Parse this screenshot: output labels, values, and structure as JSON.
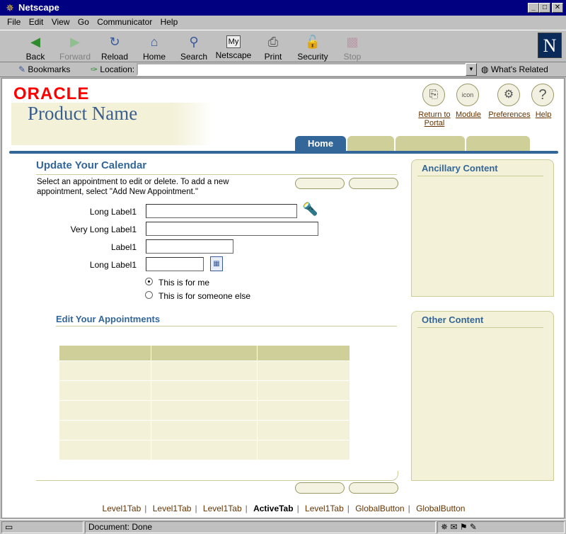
{
  "window": {
    "title": "Netscape"
  },
  "menu": [
    "File",
    "Edit",
    "View",
    "Go",
    "Communicator",
    "Help"
  ],
  "toolbar": [
    {
      "label": "Back",
      "icon": "back-arrow-icon",
      "enabled": true
    },
    {
      "label": "Forward",
      "icon": "forward-arrow-icon",
      "enabled": false
    },
    {
      "label": "Reload",
      "icon": "reload-icon",
      "enabled": true
    },
    {
      "label": "Home",
      "icon": "home-icon",
      "enabled": true
    },
    {
      "label": "Search",
      "icon": "search-icon",
      "enabled": true
    },
    {
      "label": "Netscape",
      "icon": "my-netscape-icon",
      "enabled": true
    },
    {
      "label": "Print",
      "icon": "print-icon",
      "enabled": true
    },
    {
      "label": "Security",
      "icon": "lock-icon",
      "enabled": true
    },
    {
      "label": "Stop",
      "icon": "stop-icon",
      "enabled": false
    }
  ],
  "locationbar": {
    "bookmarks": "Bookmarks",
    "location_label": "Location:",
    "url": "",
    "whats_related": "What's Related"
  },
  "brand": {
    "oracle": "ORACLE",
    "product": "Product Name"
  },
  "global_buttons": [
    {
      "label_line1": "Return to",
      "label_line2": "Portal",
      "icon": "portal-icon"
    },
    {
      "label_line1": "Module",
      "label_line2": "",
      "icon_text": "icon",
      "icon": "module-icon"
    },
    {
      "label_line1": "Preferences",
      "label_line2": "",
      "icon": "preferences-icon"
    },
    {
      "label_line1": "Help",
      "label_line2": "",
      "icon": "help-icon",
      "icon_text": "?"
    }
  ],
  "tabs": {
    "active": "Home"
  },
  "main": {
    "title": "Update Your Calendar",
    "instructions_line1": "Select an appointment to edit or delete. To add a new",
    "instructions_line2": "appointment, select \"Add New Appointment.\"",
    "fields": [
      {
        "label": "Long Label1",
        "value": ""
      },
      {
        "label": "Very Long Label1",
        "value": ""
      },
      {
        "label": "Label1",
        "value": ""
      },
      {
        "label": "Long Label1",
        "value": ""
      }
    ],
    "radios": [
      {
        "label": "This is for me",
        "checked": true
      },
      {
        "label": "This is for someone else",
        "checked": false
      }
    ],
    "section_title": "Edit Your Appointments"
  },
  "side": {
    "ancillary_title": "Ancillary Content",
    "other_title": "Other Content"
  },
  "footer_links": [
    {
      "label": "Level1Tab",
      "active": false
    },
    {
      "label": "Level1Tab",
      "active": false
    },
    {
      "label": "Level1Tab",
      "active": false
    },
    {
      "label": "ActiveTab",
      "active": true
    },
    {
      "label": "Level1Tab",
      "active": false
    },
    {
      "label": "GlobalButton",
      "active": false
    },
    {
      "label": "GlobalButton",
      "active": false
    }
  ],
  "status": {
    "text": "Document: Done"
  },
  "colors": {
    "accent": "#336699",
    "tab_inactive": "#cfcf9a",
    "panel_bg": "#f3f1d8",
    "oracle_red": "#ff0000",
    "link": "#663300"
  }
}
